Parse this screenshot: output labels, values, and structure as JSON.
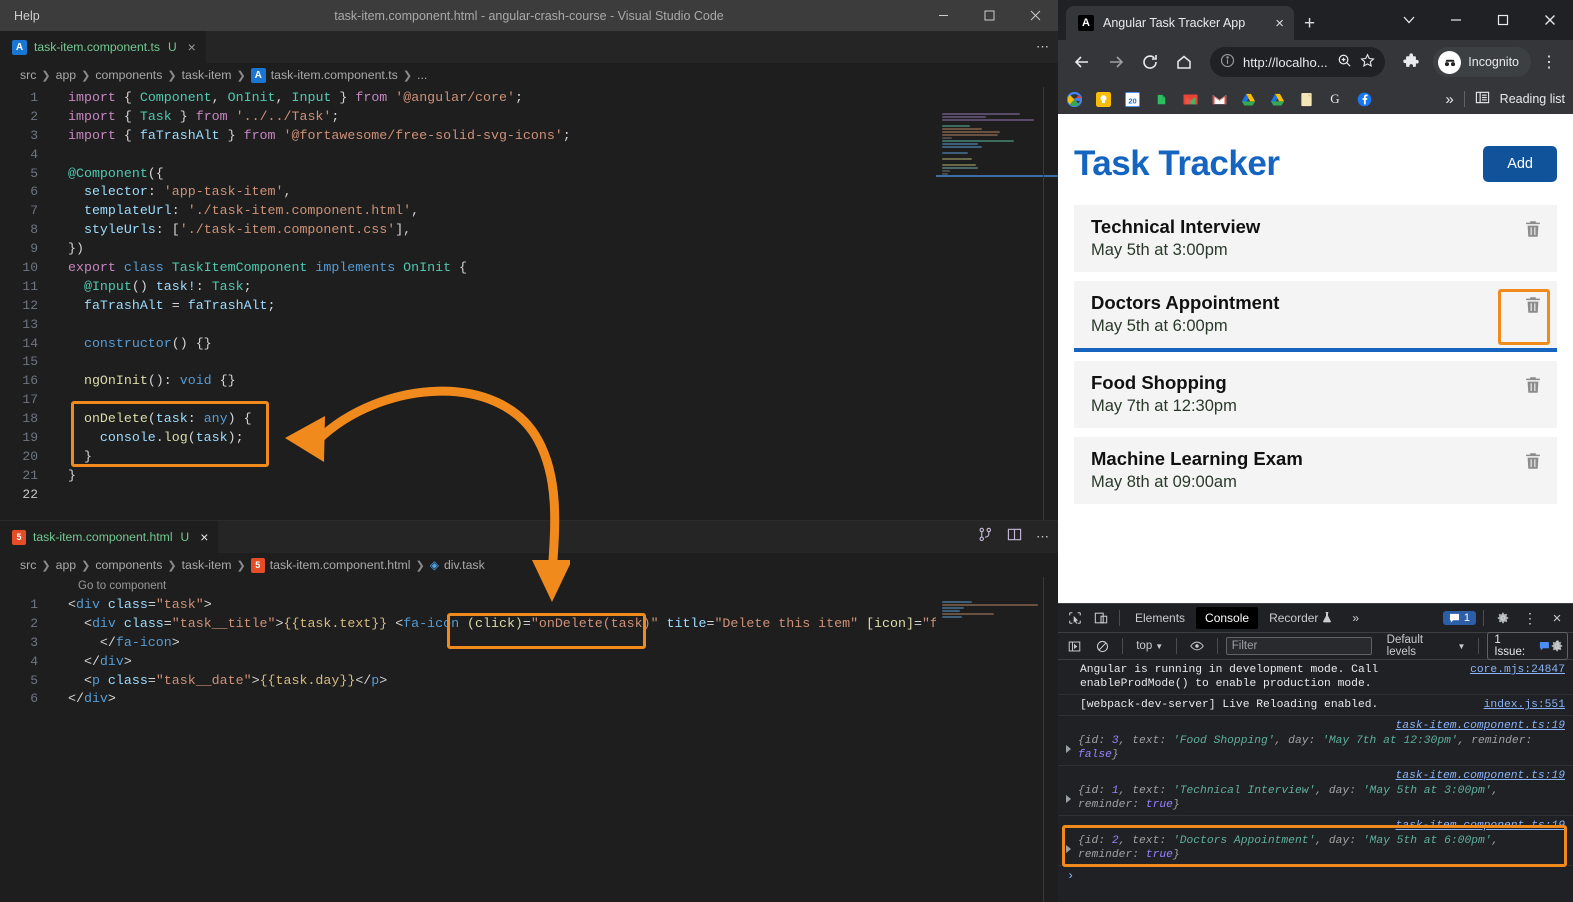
{
  "vscode": {
    "menu": [
      "Help"
    ],
    "window_title": "task-item.component.html - angular-crash-course - Visual Studio Code",
    "editor_top": {
      "tab": {
        "label": "task-item.component.ts",
        "dirty": "U",
        "close": "×",
        "icon": "angular-icon"
      },
      "breadcrumb": [
        "src",
        "app",
        "components",
        "task-item",
        "task-item.component.ts",
        "..."
      ],
      "lines": [
        {
          "n": "1",
          "text": "import { Component, OnInit, Input } from '@angular/core';"
        },
        {
          "n": "2",
          "text": "import { Task } from '../../Task';"
        },
        {
          "n": "3",
          "text": "import { faTrashAlt } from '@fortawesome/free-solid-svg-icons';"
        },
        {
          "n": "4",
          "text": ""
        },
        {
          "n": "5",
          "text": "@Component({"
        },
        {
          "n": "6",
          "text": "  selector: 'app-task-item',"
        },
        {
          "n": "7",
          "text": "  templateUrl: './task-item.component.html',"
        },
        {
          "n": "8",
          "text": "  styleUrls: ['./task-item.component.css'],"
        },
        {
          "n": "9",
          "text": "})"
        },
        {
          "n": "10",
          "text": "export class TaskItemComponent implements OnInit {"
        },
        {
          "n": "11",
          "text": "  @Input() task!: Task;"
        },
        {
          "n": "12",
          "text": "  faTrashAlt = faTrashAlt;"
        },
        {
          "n": "13",
          "text": ""
        },
        {
          "n": "14",
          "text": "  constructor() {}"
        },
        {
          "n": "15",
          "text": ""
        },
        {
          "n": "16",
          "text": "  ngOnInit(): void {}"
        },
        {
          "n": "17",
          "text": ""
        },
        {
          "n": "18",
          "text": "  onDelete(task: any) {"
        },
        {
          "n": "19",
          "text": "    console.log(task);"
        },
        {
          "n": "20",
          "text": "  }"
        },
        {
          "n": "21",
          "text": "}"
        },
        {
          "n": "22",
          "text": ""
        }
      ]
    },
    "editor_bottom": {
      "tab": {
        "label": "task-item.component.html",
        "dirty": "U",
        "close": "×",
        "icon": "html5-icon"
      },
      "breadcrumb": [
        "src",
        "app",
        "components",
        "task-item",
        "task-item.component.html",
        "div.task"
      ],
      "codelens": "Go to component",
      "lines": [
        {
          "n": "1",
          "text": "<div class=\"task\">"
        },
        {
          "n": "2",
          "text": "  <div class=\"task__title\">{{task.text}} <fa-icon (click)=\"onDelete(task)\" title=\"Delete this item\" [icon]=\"faTr"
        },
        {
          "n": "3",
          "text": "    </fa-icon>"
        },
        {
          "n": "4",
          "text": "  </div>"
        },
        {
          "n": "5",
          "text": "  <p class=\"task__date\">{{task.day}}</p>"
        },
        {
          "n": "6",
          "text": "</div>"
        }
      ]
    },
    "annotations": {
      "color": "#f18a1c",
      "ts_highlight_label": "onDelete method block",
      "html_highlight_label": "(click)=\"onDelete(task)\" binding"
    }
  },
  "chrome": {
    "tab": {
      "title": "Angular Task Tracker App",
      "favicon": "angular-icon",
      "close": "×"
    },
    "new_tab": "+",
    "window_controls": {
      "list": "⌄",
      "minimize": "–",
      "maximize": "□",
      "close": "×"
    },
    "toolbar": {
      "back": "←",
      "forward": "→",
      "reload": "⟳",
      "home": "⌂",
      "url": "http://localho...",
      "site_info": "ⓘ",
      "zoom_icon": "search-plus-icon",
      "bookmark_icon": "star-icon",
      "extensions_icon": "puzzle-icon",
      "profile_label": "Incognito",
      "menu": "⋮"
    },
    "bookmarks": {
      "items": [
        "google-icon",
        "keep-icon",
        "calendar-icon",
        "evernote-icon",
        "gmail-icon",
        "gmail-icon",
        "drive-icon",
        "drive-icon",
        "docs-icon",
        "google-g-icon",
        "facebook-icon"
      ],
      "overflow": "»",
      "reading_list": "Reading list"
    }
  },
  "app": {
    "title": "Task Tracker",
    "add_button": "Add",
    "accent_color": "#1565c0",
    "tasks": [
      {
        "title": "Technical Interview",
        "date": "May 5th at 3:00pm",
        "reminder": false
      },
      {
        "title": "Doctors Appointment",
        "date": "May 5th at 6:00pm",
        "reminder": true
      },
      {
        "title": "Food Shopping",
        "date": "May 7th at 12:30pm",
        "reminder": false
      },
      {
        "title": "Machine Learning Exam",
        "date": "May 8th at 09:00am",
        "reminder": false
      }
    ]
  },
  "devtools": {
    "tabs": [
      {
        "label": "Elements",
        "active": false
      },
      {
        "label": "Console",
        "active": true
      },
      {
        "label": "Recorder",
        "active": false,
        "badge": "flask-icon"
      }
    ],
    "overflow": "»",
    "message_count": "1",
    "settings_icon": "gear-icon",
    "more_icon": "⋮",
    "close_icon": "×",
    "toolbar2": {
      "sidebar_icon": "show-console-sidebar-icon",
      "clear_icon": "clear-console-icon",
      "context": "top",
      "eye_icon": "live-expression-icon",
      "filter_placeholder": "Filter",
      "levels": "Default levels",
      "issues": "1 Issue:",
      "issues_count": "1",
      "settings_icon": "gear-icon"
    },
    "messages": [
      {
        "type": "text",
        "text": "Angular is running in development mode. Call enableProdMode() to enable production mode.",
        "source": "core.mjs:24847",
        "source_below": false,
        "expandable": false,
        "highlighted": false
      },
      {
        "type": "text",
        "text": "[webpack-dev-server] Live Reloading enabled.",
        "source": "index.js:551",
        "source_below": false,
        "expandable": false,
        "highlighted": false
      },
      {
        "type": "object",
        "source": "task-item.component.ts:19",
        "source_below": true,
        "expandable": true,
        "highlighted": false,
        "obj": {
          "id": "3",
          "text": "'Food Shopping'",
          "day": "'May 7th at 12:30pm'",
          "reminder": "false"
        }
      },
      {
        "type": "object",
        "source": "task-item.component.ts:19",
        "source_below": true,
        "expandable": true,
        "highlighted": false,
        "obj": {
          "id": "1",
          "text": "'Technical Interview'",
          "day": "'May 5th at 3:00pm'",
          "reminder": "true"
        }
      },
      {
        "type": "object",
        "source": "task-item.component.ts:19",
        "source_below": true,
        "expandable": true,
        "highlighted": true,
        "obj": {
          "id": "2",
          "text": "'Doctors Appointment'",
          "day": "'May 5th at 6:00pm'",
          "reminder": "true"
        }
      }
    ],
    "prompt": "›"
  }
}
